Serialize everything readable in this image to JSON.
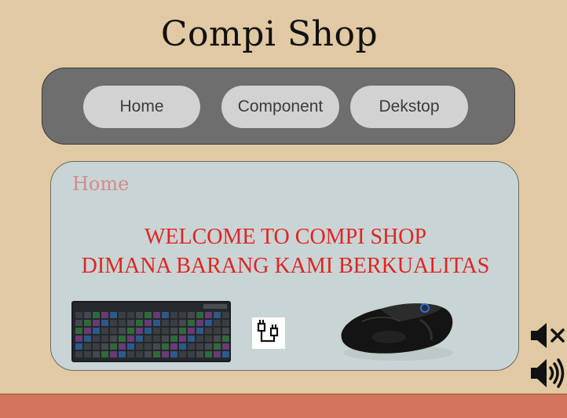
{
  "header": {
    "title": "Compi Shop"
  },
  "nav": {
    "items": [
      {
        "label": "Home"
      },
      {
        "label": "Component"
      },
      {
        "label": "Dekstop"
      }
    ]
  },
  "main": {
    "section_label": "Home",
    "welcome_line1": "WELCOME  TO COMPI SHOP",
    "welcome_line2": "DIMANA BARANG KAMI BERKUALITAS"
  },
  "images": {
    "keyboard": "keyboard-image",
    "cable": "usb-plug-icon",
    "mouse": "gaming-mouse-image"
  },
  "controls": {
    "mute": "mute-icon",
    "volume": "volume-icon"
  },
  "colors": {
    "background": "#e1c9a3",
    "nav": "#6e6e6e",
    "nav_button": "#d3d2d2",
    "panel": "#c9d4d4",
    "welcome_text": "#e02424",
    "footer": "#d2745e"
  }
}
